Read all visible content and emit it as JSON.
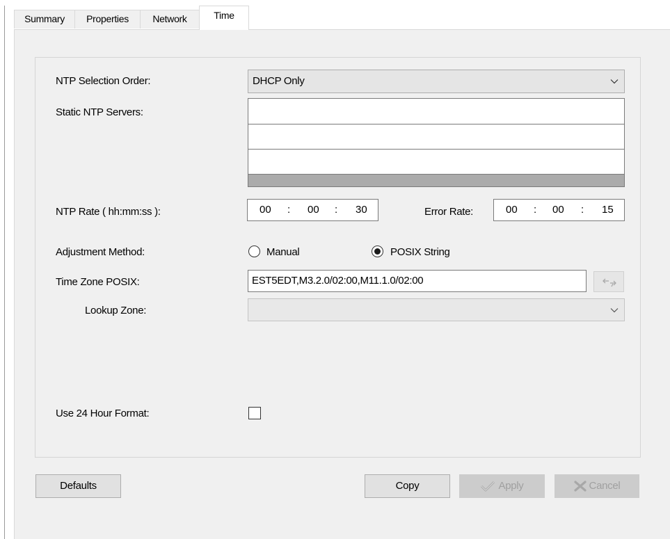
{
  "tabs": [
    {
      "label": "Summary"
    },
    {
      "label": "Properties"
    },
    {
      "label": "Network"
    },
    {
      "label": "Time"
    }
  ],
  "form": {
    "ntp_selection_order": {
      "label": "NTP Selection Order:",
      "value": "DHCP Only"
    },
    "static_ntp_servers": {
      "label": "Static NTP Servers:",
      "rows": [
        "",
        "",
        ""
      ]
    },
    "ntp_rate": {
      "label": "NTP Rate ( hh:mm:ss ):",
      "hh": "00",
      "mm": "00",
      "ss": "30",
      "separator": ":"
    },
    "error_rate": {
      "label": "Error Rate:",
      "hh": "00",
      "mm": "00",
      "ss": "15",
      "separator": ":"
    },
    "adjustment_method": {
      "label": "Adjustment Method:",
      "options": [
        "Manual",
        "POSIX String"
      ],
      "selected": "POSIX String"
    },
    "time_zone_posix": {
      "label": "Time Zone POSIX:",
      "value": "EST5EDT,M3.2.0/02:00,M11.1.0/02:00"
    },
    "lookup_zone": {
      "label": "Lookup Zone:",
      "value": ""
    },
    "use_24_hour": {
      "label": "Use 24 Hour Format:",
      "checked": false
    }
  },
  "buttons": {
    "defaults": "Defaults",
    "copy": "Copy",
    "apply": "Apply",
    "cancel": "Cancel"
  },
  "icons": {
    "dropdown": "chevron-down-icon",
    "convert": "swap-arrows-icon",
    "apply": "checkmark-icon",
    "cancel": "x-icon"
  },
  "colors": {
    "panel_bg": "#f0f0f0",
    "disabled_button": "#cccccc",
    "disabled_text": "#a0a0a0"
  }
}
